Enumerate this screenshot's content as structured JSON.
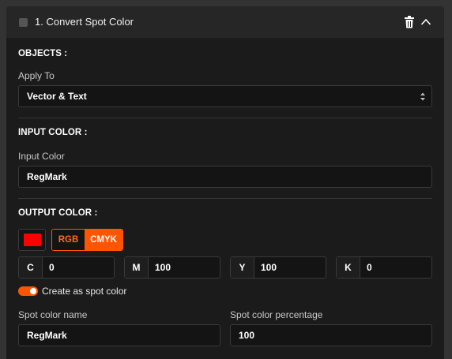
{
  "header": {
    "title": "1.  Convert Spot Color",
    "icons": [
      "trash-icon",
      "chevron-up-icon"
    ]
  },
  "objects": {
    "section_title": "OBJECTS :",
    "apply_to_label": "Apply To",
    "apply_to_value": "Vector & Text"
  },
  "input_color": {
    "section_title": "INPUT COLOR :",
    "label": "Input Color",
    "value": "RegMark"
  },
  "output_color": {
    "section_title": "OUTPUT COLOR :",
    "swatch_color": "#ff0000",
    "modes": [
      "RGB",
      "CMYK"
    ],
    "active_mode": "CMYK",
    "accent_color": "#ff5500",
    "channels": [
      {
        "letter": "C",
        "value": "0"
      },
      {
        "letter": "M",
        "value": "100"
      },
      {
        "letter": "Y",
        "value": "100"
      },
      {
        "letter": "K",
        "value": "0"
      }
    ],
    "spot_toggle_label": "Create as spot color",
    "spot_toggle_on": true,
    "spot_name_label": "Spot color name",
    "spot_name_value": "RegMark",
    "spot_percentage_label": "Spot color percentage",
    "spot_percentage_value": "100"
  }
}
